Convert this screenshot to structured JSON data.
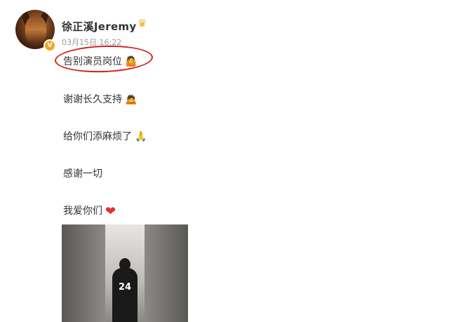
{
  "user": {
    "name": "徐正溪Jeremy",
    "verified_badge": "V",
    "avatar_icon": "avatar"
  },
  "post": {
    "timestamp": "03月15日 16:22",
    "lines": [
      {
        "text": "告别演员岗位",
        "emoji": "🤷"
      },
      {
        "text": "谢谢长久支持",
        "emoji": "🙇"
      },
      {
        "text": "给你们添麻烦了",
        "emoji": "🙏"
      },
      {
        "text": "感谢一切",
        "emoji": ""
      },
      {
        "text": "我爱你们",
        "emoji": "❤"
      }
    ],
    "image": {
      "jersey_number": "24"
    }
  },
  "colors": {
    "highlight": "#d3201e",
    "heart": "#e0302a",
    "crown": "#f2b01e"
  }
}
